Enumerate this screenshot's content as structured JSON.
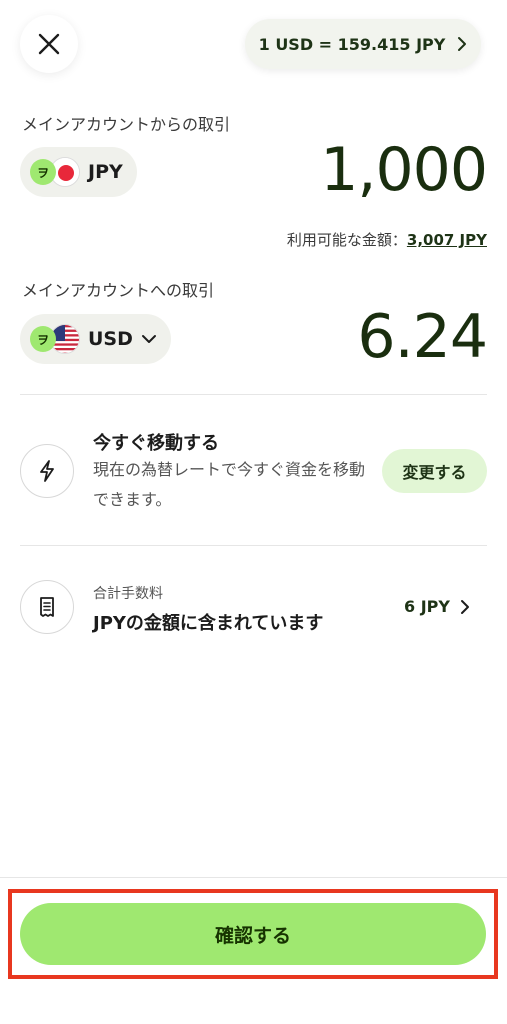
{
  "header": {
    "close_icon": "close-icon",
    "rate_text": "1 USD = 159.415 JPY",
    "rate_chevron": "chevron-right-icon"
  },
  "from": {
    "label": "メインアカウントからの取引",
    "badge": "ヲ",
    "currency": "JPY",
    "amount": "1,000",
    "available_label": "利用可能な金額：",
    "available_value": "3,007 JPY"
  },
  "to": {
    "label": "メインアカウントへの取引",
    "badge": "ヲ",
    "currency": "USD",
    "amount": "6.24"
  },
  "move_now": {
    "icon": "lightning-icon",
    "title": "今すぐ移動する",
    "description": "現在の為替レートで今すぐ資金を移動できます。",
    "button": "変更する"
  },
  "fee": {
    "icon": "receipt-icon",
    "subtitle": "合計手数料",
    "title": "JPYの金額に含まれています",
    "value": "6 JPY"
  },
  "footer": {
    "confirm": "確認する"
  },
  "colors": {
    "brand_green": "#9fe870",
    "dark_green": "#163300",
    "highlight_red": "#e8371f"
  }
}
